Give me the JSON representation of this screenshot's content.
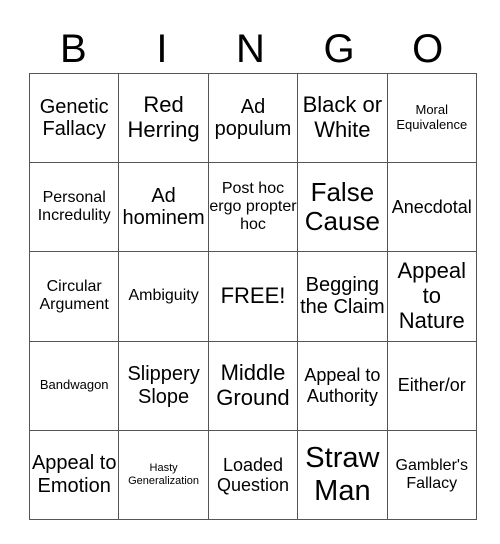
{
  "header": {
    "letters": [
      "B",
      "I",
      "N",
      "G",
      "O"
    ]
  },
  "grid": {
    "rows": [
      [
        "Genetic Fallacy",
        "Red Herring",
        "Ad populum",
        "Black or White",
        "Moral Equivalence"
      ],
      [
        "Personal Incredulity",
        "Ad hominem",
        "Post hoc ergo propter hoc",
        "False Cause",
        "Anecdotal"
      ],
      [
        "Circular Argument",
        "Ambiguity",
        "FREE!",
        "Begging the Claim",
        "Appeal to Nature"
      ],
      [
        "Bandwagon",
        "Slippery Slope",
        "Middle Ground",
        "Appeal to Authority",
        "Either/or"
      ],
      [
        "Appeal to Emotion",
        "Hasty Generalization",
        "Loaded Question",
        "Straw Man",
        "Gambler's Fallacy"
      ]
    ]
  }
}
